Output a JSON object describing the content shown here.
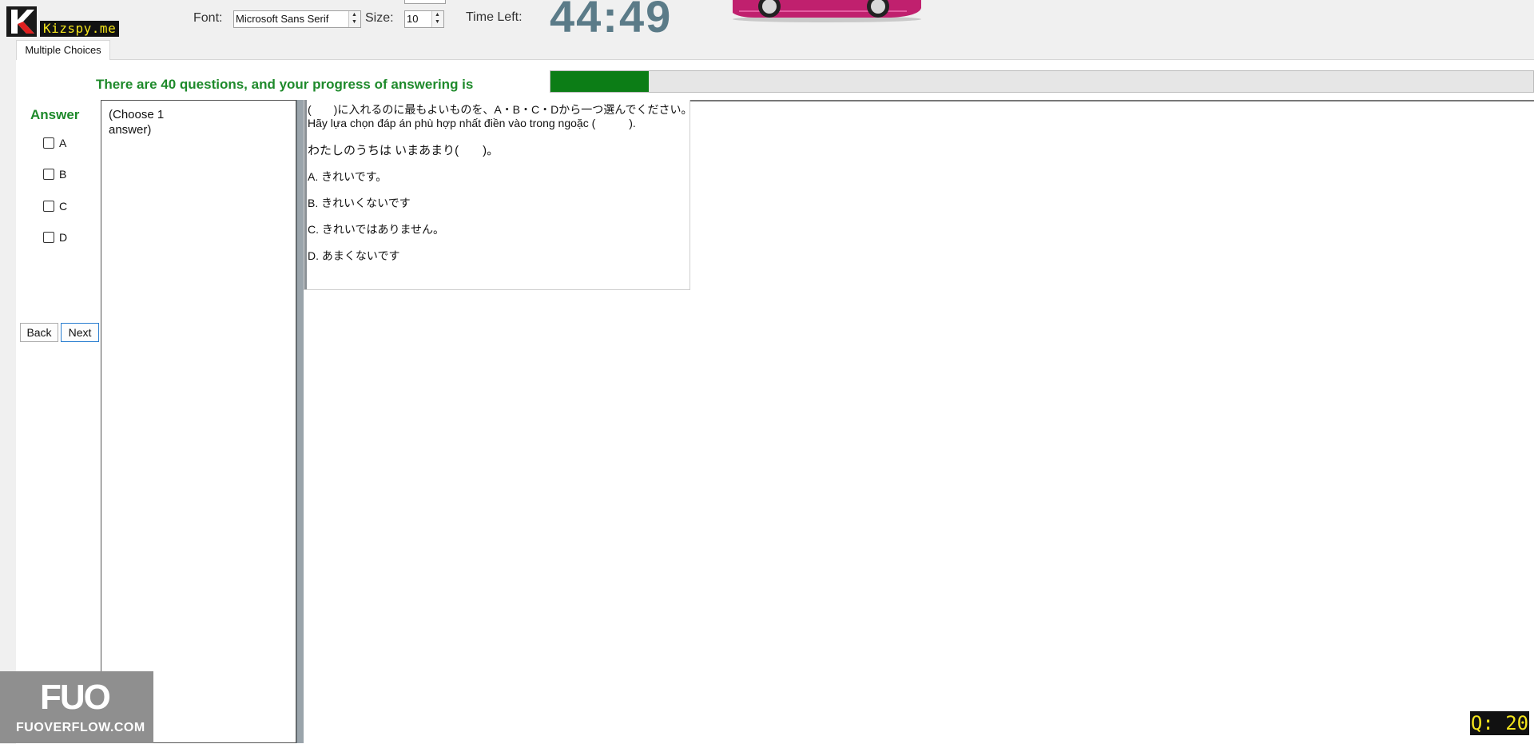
{
  "brand": {
    "name": "Kizspy.me",
    "accent_color": "#f3e41c"
  },
  "toolbar": {
    "font_label": "Font:",
    "font_value": "Microsoft Sans Serif",
    "size_label": "Size:",
    "size_value": "10",
    "time_label": "Time Left:",
    "timer": "44:49"
  },
  "tab": {
    "label": "Multiple Choices"
  },
  "progress": {
    "text": "There are 40 questions, and your progress of answering is",
    "fraction": 0.1,
    "fill_color": "#0c7d16"
  },
  "answer": {
    "title": "Answer",
    "options": [
      "A",
      "B",
      "C",
      "D"
    ]
  },
  "nav": {
    "back_label": "Back",
    "next_label": "Next"
  },
  "instruction": "(Choose 1 answer)",
  "question": {
    "line1": "(　　)に入れるのに最もよいものを、A・B・C・Dから一つ選んでください。",
    "line2": "Hãy lựa chọn đáp án phù hợp nhất điền vào trong ngoặc (　　　).",
    "sentence": "わたしのうちは いまあまり(　　)。",
    "choices": [
      {
        "letter": "A.",
        "text": "きれいです。"
      },
      {
        "letter": "B.",
        "text": "きれいくないです"
      },
      {
        "letter": "C.",
        "text": "きれいではありません。"
      },
      {
        "letter": "D.",
        "text": "あまくないです"
      }
    ]
  },
  "watermark": {
    "logo": "FUO",
    "site": "FUOVERFLOW.COM"
  },
  "question_counter": "Q: 20"
}
